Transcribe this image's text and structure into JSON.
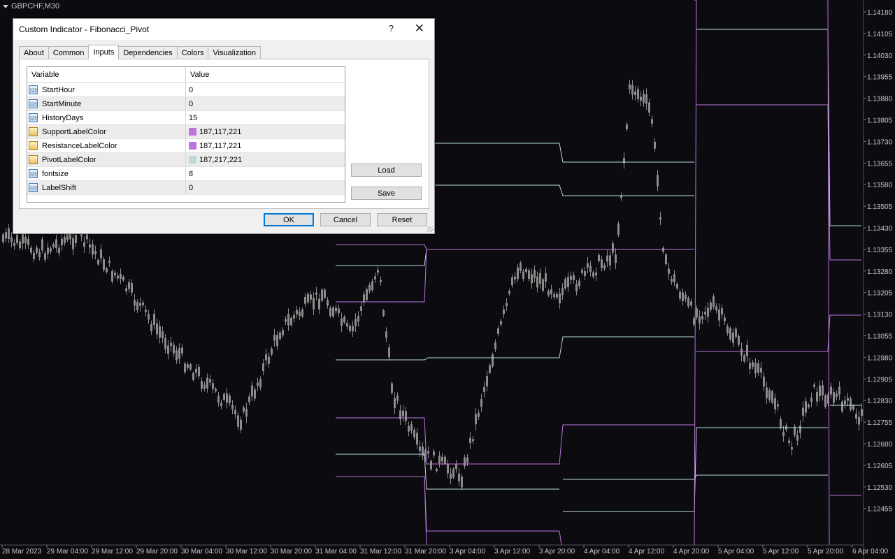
{
  "chart": {
    "symbol": "GBPCHF,M30",
    "price_labels": [
      "1.14180",
      "1.14105",
      "1.14030",
      "1.13955",
      "1.13880",
      "1.13805",
      "1.13730",
      "1.13655",
      "1.13580",
      "1.13505",
      "1.13430",
      "1.13355",
      "1.13280",
      "1.13205",
      "1.13130",
      "1.13055",
      "1.12980",
      "1.12905",
      "1.12830",
      "1.12755",
      "1.12680",
      "1.12605",
      "1.12530",
      "1.12455"
    ],
    "time_labels": [
      "28 Mar 2023",
      "29 Mar 04:00",
      "29 Mar 12:00",
      "29 Mar 20:00",
      "30 Mar 04:00",
      "30 Mar 12:00",
      "30 Mar 20:00",
      "31 Mar 04:00",
      "31 Mar 12:00",
      "31 Mar 20:00",
      "3 Apr 04:00",
      "3 Apr 12:00",
      "3 Apr 20:00",
      "4 Apr 04:00",
      "4 Apr 12:00",
      "4 Apr 20:00",
      "5 Apr 04:00",
      "5 Apr 12:00",
      "5 Apr 20:00",
      "6 Apr 04:00"
    ],
    "colors": {
      "background": "#0b0b10",
      "candles": "#8c8c8c",
      "support": "#bb75dd",
      "resistance": "#bb75dd",
      "pivot": "#bbd9dd",
      "axis_text": "#c8c8c8"
    }
  },
  "dialog": {
    "title": "Custom Indicator - Fibonacci_Pivot",
    "help_label": "?",
    "close_label": "✕",
    "tabs": [
      {
        "label": "About"
      },
      {
        "label": "Common"
      },
      {
        "label": "Inputs"
      },
      {
        "label": "Dependencies"
      },
      {
        "label": "Colors"
      },
      {
        "label": "Visualization"
      }
    ],
    "active_tab": "Inputs",
    "grid": {
      "headers": {
        "variable": "Variable",
        "value": "Value"
      },
      "rows": [
        {
          "name": "StartHour",
          "value": "0",
          "type": "number",
          "icon_text": "123"
        },
        {
          "name": "StartMinute",
          "value": "0",
          "type": "number",
          "icon_text": "123"
        },
        {
          "name": "HistoryDays",
          "value": "15",
          "type": "number",
          "icon_text": "123"
        },
        {
          "name": "SupportLabelColor",
          "value": "187,117,221",
          "type": "color",
          "swatch": "#bb75dd"
        },
        {
          "name": "ResistanceLabelColor",
          "value": "187,117,221",
          "type": "color",
          "swatch": "#bb75dd"
        },
        {
          "name": "PivotLabelColor",
          "value": "187,217,221",
          "type": "color",
          "swatch": "#bbd9dd"
        },
        {
          "name": "fontsize",
          "value": "8",
          "type": "number",
          "icon_text": "123"
        },
        {
          "name": "LabelShift",
          "value": "0",
          "type": "number",
          "icon_text": "123"
        }
      ]
    },
    "buttons": {
      "load": "Load",
      "save": "Save",
      "ok": "OK",
      "cancel": "Cancel",
      "reset": "Reset"
    }
  }
}
